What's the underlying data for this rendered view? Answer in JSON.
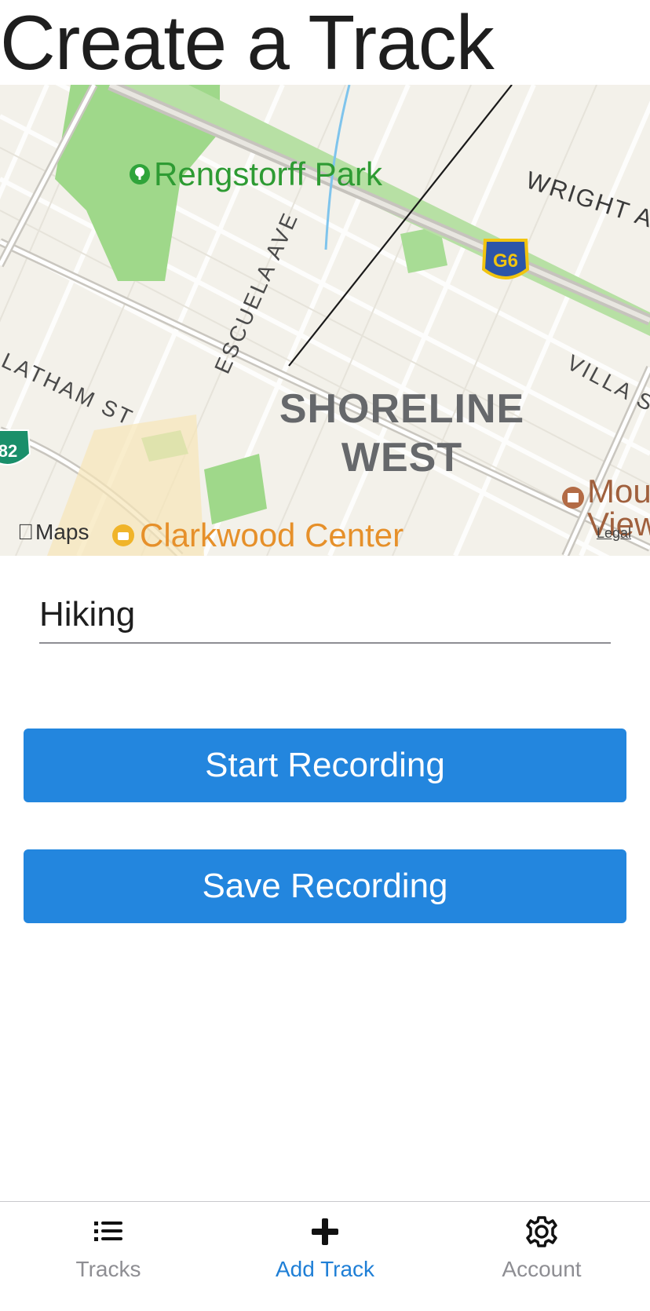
{
  "page": {
    "title": "Create a Track"
  },
  "map": {
    "park_label": "Rengstorff Park",
    "streets": [
      "WRIGHT A",
      "ESCUELA AVE",
      "LATHAM ST",
      "VILLA S"
    ],
    "district_line1": "SHORELINE",
    "district_line2": "WEST",
    "shield_g6": "G6",
    "shield_82": "82",
    "clarkwood": "Clarkwood Center",
    "mountain_view_line1": "Mou",
    "mountain_view_line2": "View",
    "attribution": "Maps",
    "legal": "Legal",
    "colors": {
      "land": "#f3f1ea",
      "park": "#9fd88a",
      "road": "#ffffff",
      "water": "#7fc4ec",
      "route": "#1a1a1a"
    }
  },
  "form": {
    "track_name_value": "Hiking",
    "start_button": "Start Recording",
    "save_button": "Save Recording",
    "button_color": "#2386de"
  },
  "tabbar": {
    "items": [
      {
        "label": "Tracks",
        "icon": "list-icon"
      },
      {
        "label": "Add Track",
        "icon": "plus-icon",
        "active": true
      },
      {
        "label": "Account",
        "icon": "gear-icon"
      }
    ]
  }
}
